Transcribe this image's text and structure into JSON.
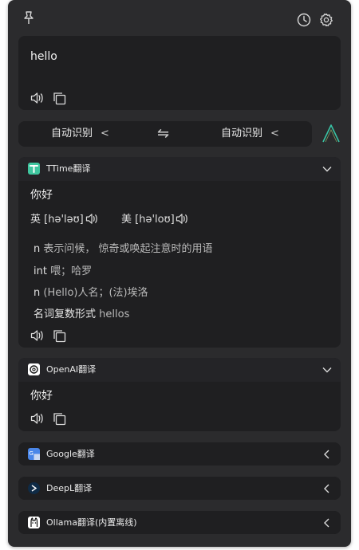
{
  "input": {
    "text": "hello"
  },
  "lang_bar": {
    "source": "自动识别",
    "target": "自动识别",
    "swap": "⇋"
  },
  "ttime": {
    "name": "TTime翻译",
    "result": "你好",
    "phonetic_uk_label": "英",
    "phonetic_uk": "[hə'ləʊ]",
    "phonetic_us_label": "美",
    "phonetic_us": "[hə'loʊ]",
    "definitions": [
      {
        "pos": "n",
        "text": "表示问候， 惊奇或唤起注意时的用语"
      },
      {
        "pos": "int",
        "text": "喂；哈罗"
      },
      {
        "pos": "n",
        "text": "(Hello)人名；(法)埃洛"
      }
    ],
    "plural_label": "名词复数形式",
    "plural_value": "hellos"
  },
  "openai": {
    "name": "OpenAI翻译",
    "result": "你好"
  },
  "google": {
    "name": "Google翻译"
  },
  "deepl": {
    "name": "DeepL翻译"
  },
  "ollama": {
    "name": "Ollama翻译(内置离线)"
  },
  "colors": {
    "accent": "#39c2a4",
    "window": "#2b2b2d",
    "card": "#1f1f21"
  }
}
